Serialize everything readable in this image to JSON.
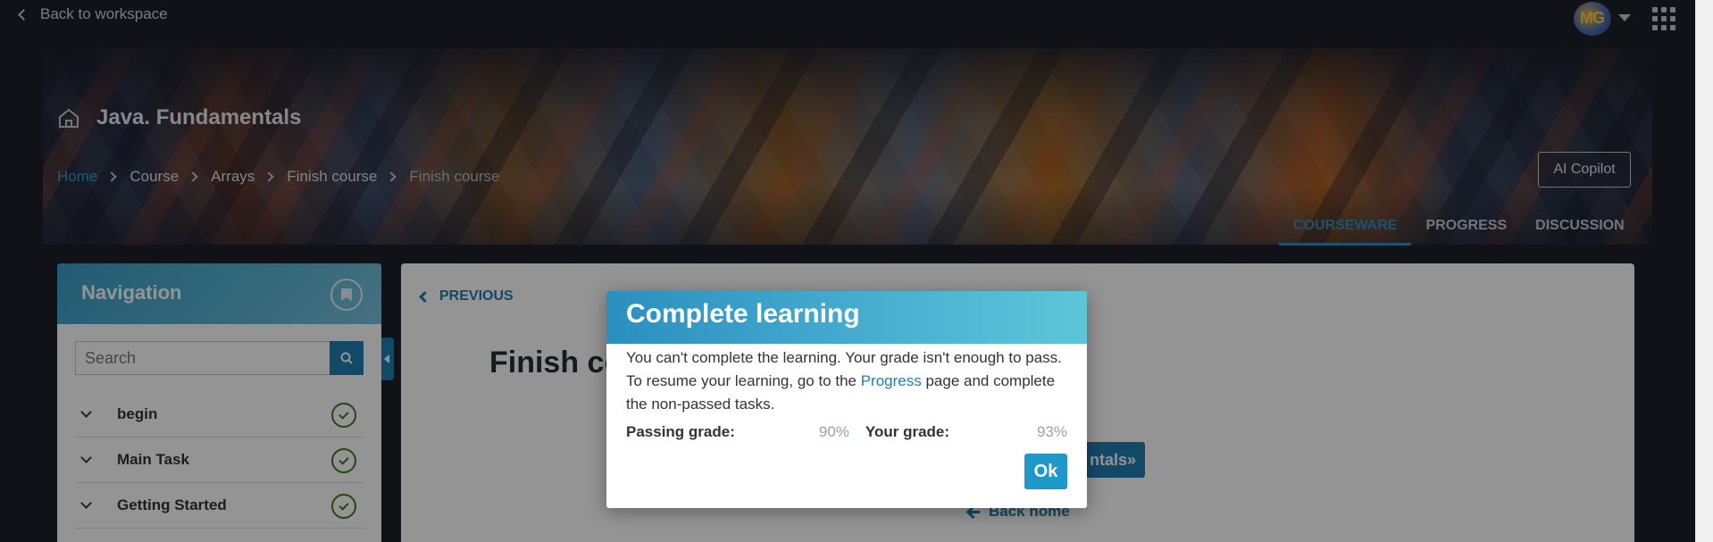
{
  "topbar": {
    "back_label": "Back to workspace",
    "avatar_initials": "MG",
    "icons": [
      "chevron-left-icon",
      "avatar",
      "caret-down-icon",
      "apps-grid-icon"
    ]
  },
  "banner": {
    "course_title": "Java. Fundamentals",
    "breadcrumb": [
      "Home",
      "Course",
      "Arrays",
      "Finish course",
      "Finish course"
    ],
    "ai_copilot_label": "AI Copilot",
    "tabs": [
      "COURSEWARE",
      "PROGRESS",
      "DISCUSSION"
    ],
    "active_tab": "COURSEWARE"
  },
  "navigation": {
    "title": "Navigation",
    "search_placeholder": "Search",
    "items": [
      {
        "label": "begin",
        "status": "completed"
      },
      {
        "label": "Main Task",
        "status": "completed"
      },
      {
        "label": "Getting Started",
        "status": "completed"
      }
    ]
  },
  "main": {
    "previous_label": "PREVIOUS",
    "unit_title": "Finish co",
    "action_button_label": "ntals»",
    "back_home_label": "Back home"
  },
  "modal": {
    "title": "Complete learning",
    "text_before_link": "You can't complete the learning. Your grade isn't enough to pass. To resume your learning, go to the ",
    "link_text": "Progress",
    "text_after_link": " page and complete the non-passed tasks.",
    "passing_grade_label": "Passing grade:",
    "passing_grade_value": "90%",
    "your_grade_label": "Your grade:",
    "your_grade_value": "93%",
    "ok_label": "Ok"
  },
  "colors": {
    "accent": "#1f7eb0",
    "page_bg": "#1c1f2a",
    "success": "#3d7a22"
  }
}
